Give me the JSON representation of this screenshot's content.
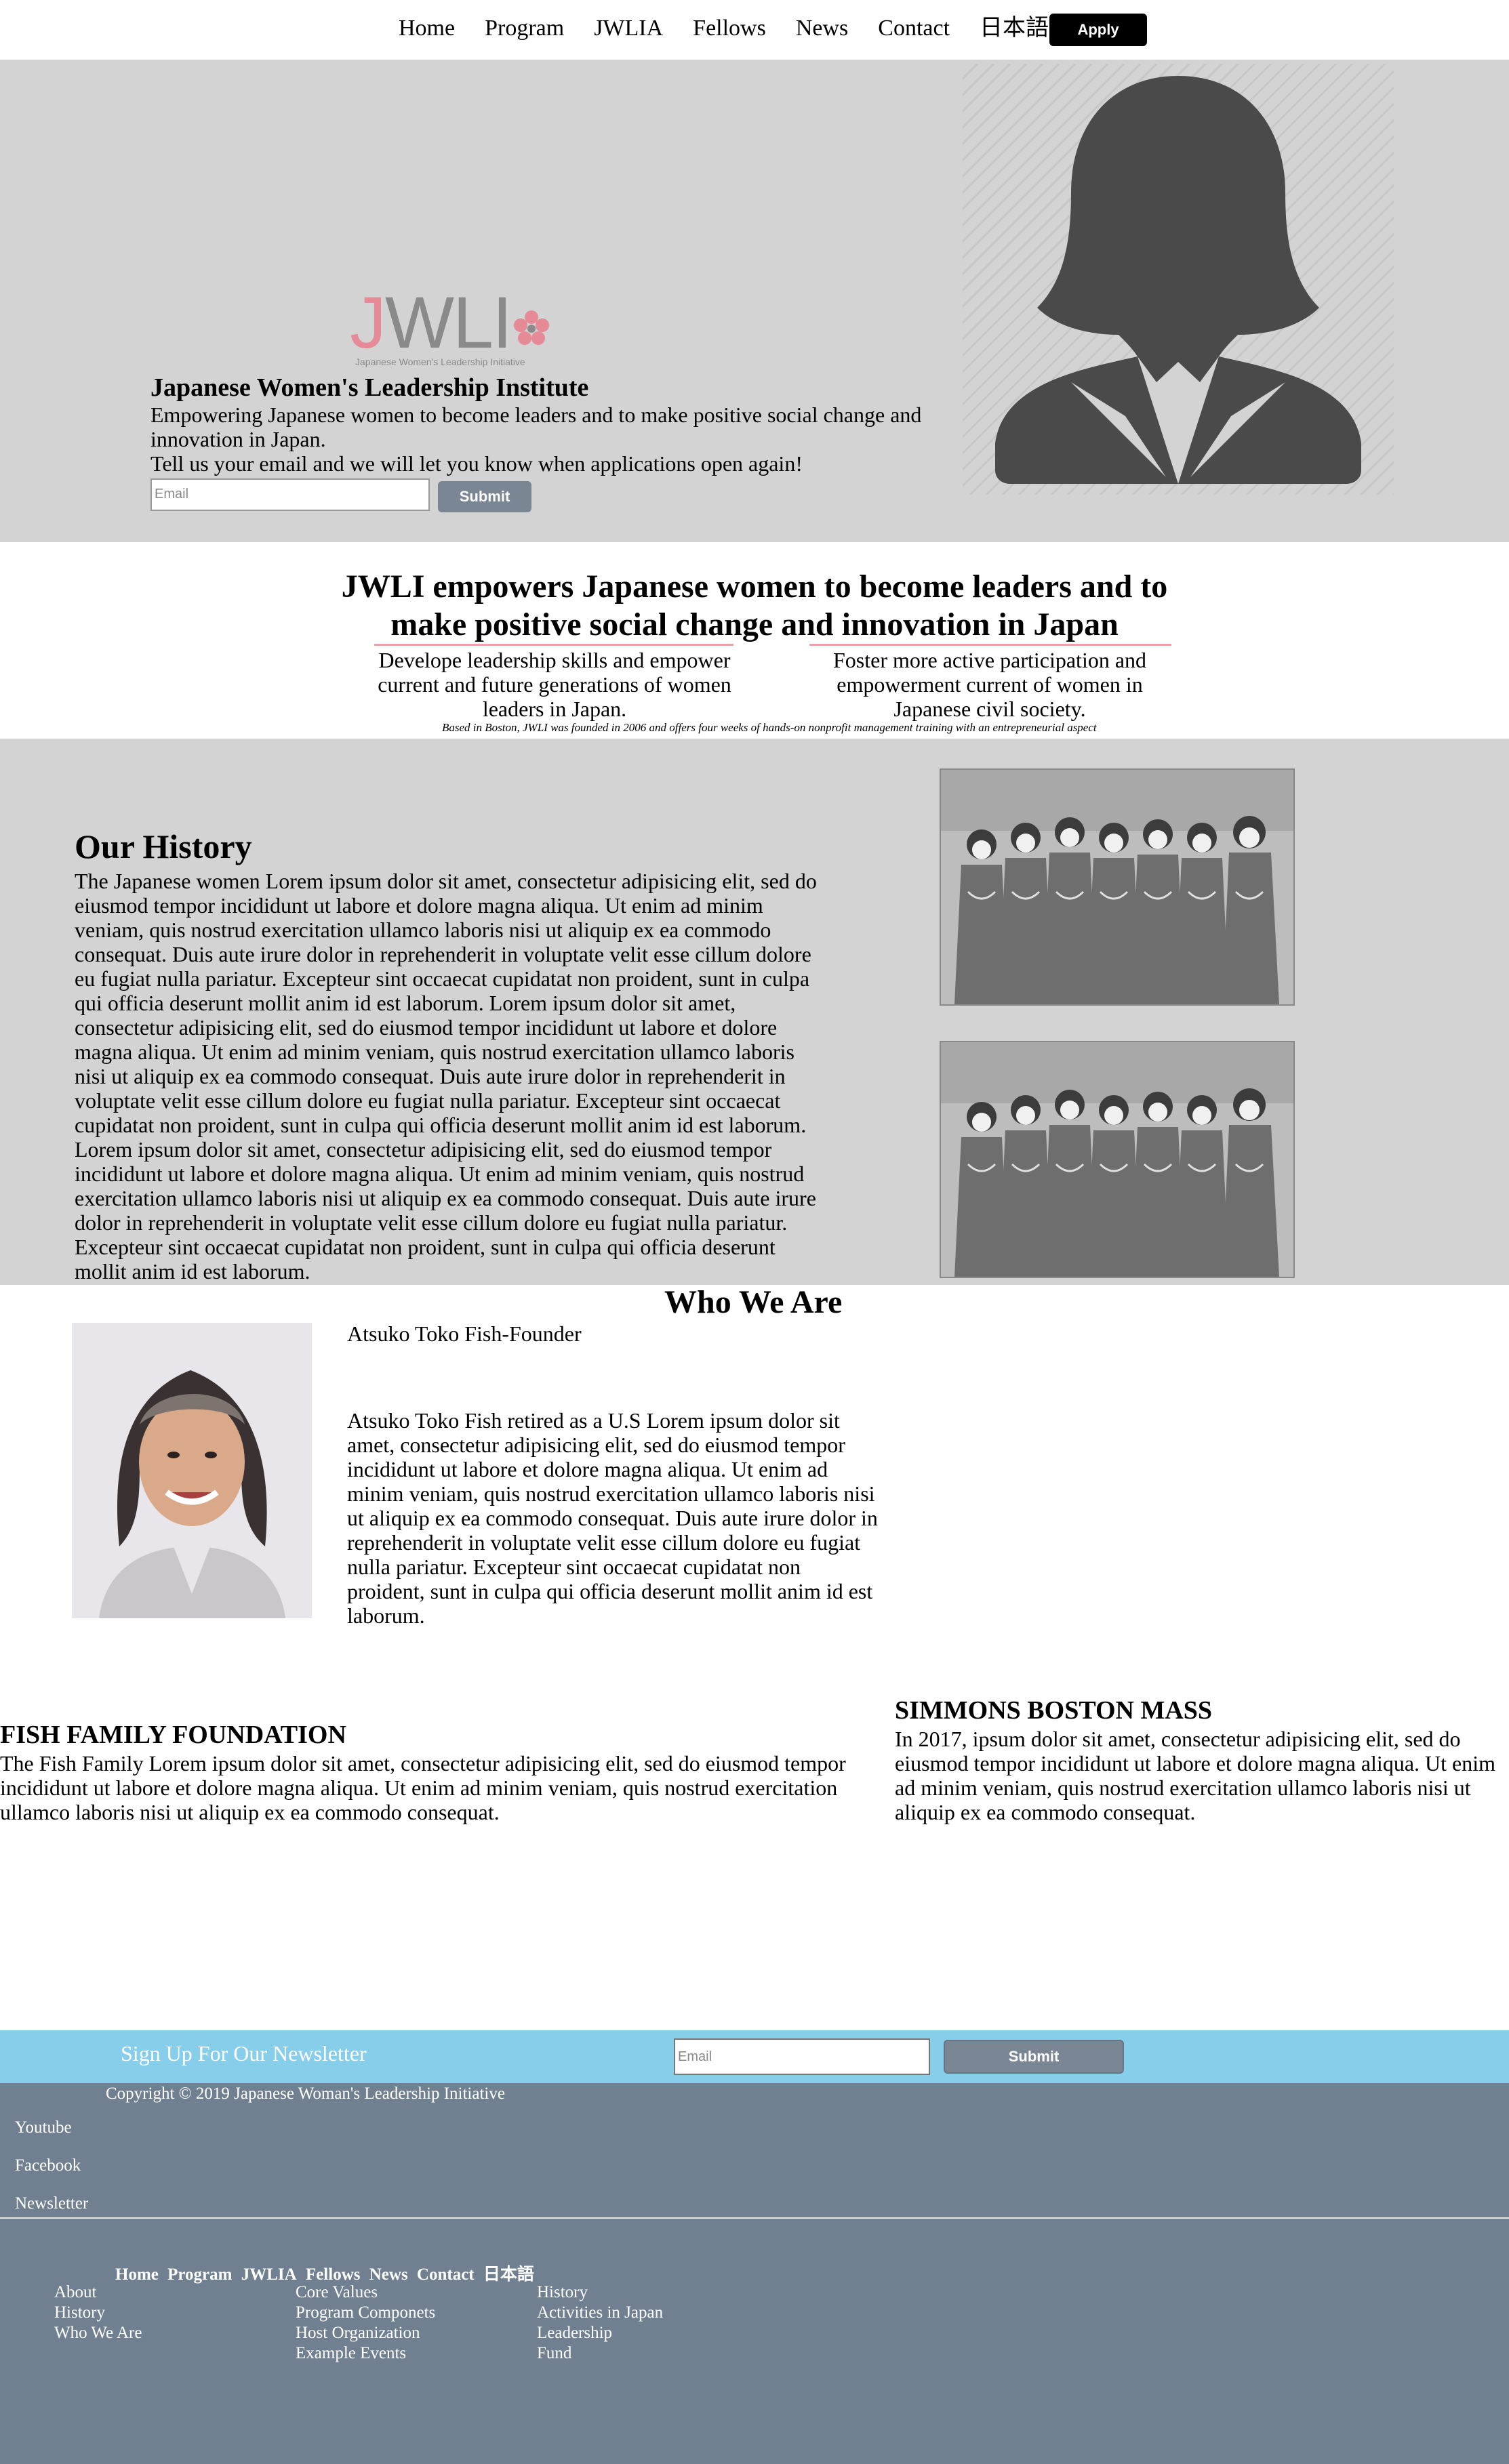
{
  "nav": {
    "items": [
      "Home",
      "Program",
      "JWLIA",
      "Fellows",
      "News",
      "Contact",
      "日本語"
    ],
    "apply_label": "Apply"
  },
  "hero": {
    "logo_text": "JWLI",
    "logo_tagline": "Japanese Women's Leadership Initiative",
    "title": "Japanese Women's Leadership Institute",
    "subtitle_1": "Empowering Japanese women to become leaders and to make positive social change and innovation in Japan.",
    "subtitle_2": "Tell us your email and we will let you know when applications open again!",
    "email_placeholder": "Email",
    "submit_label": "Submit"
  },
  "mission": {
    "headline": "JWLI empowers Japanese women to become leaders and to make positive social change and innovation in Japan",
    "col_left": "Develope leadership skills and empower current and future generations of women leaders in Japan.",
    "col_right": "Foster more active participation and empowerment current of women in Japanese civil society.",
    "note": "Based in Boston, JWLI was founded in 2006 and offers four weeks of hands-on nonprofit management training with an entrepreneurial aspect"
  },
  "history": {
    "title": "Our History",
    "text": "The Japanese women Lorem ipsum dolor sit amet, consectetur adipisicing elit, sed do eiusmod tempor incididunt ut labore et dolore magna aliqua. Ut enim ad minim veniam, quis nostrud exercitation ullamco laboris nisi ut aliquip ex ea commodo consequat. Duis aute irure dolor in reprehenderit in voluptate velit esse cillum dolore eu fugiat nulla pariatur. Excepteur sint occaecat cupidatat non proident, sunt in culpa qui officia deserunt mollit anim id est laborum. Lorem ipsum dolor sit amet, consectetur adipisicing elit, sed do eiusmod tempor incididunt ut labore et dolore magna aliqua. Ut enim ad minim veniam, quis nostrud exercitation ullamco laboris nisi ut aliquip ex ea commodo consequat. Duis aute irure dolor in reprehenderit in voluptate velit esse cillum dolore eu fugiat nulla pariatur. Excepteur sint occaecat cupidatat non proident, sunt in culpa qui officia deserunt mollit anim id est laborum. Lorem ipsum dolor sit amet, consectetur adipisicing elit, sed do eiusmod tempor incididunt ut labore et dolore magna aliqua. Ut enim ad minim veniam, quis nostrud exercitation ullamco laboris nisi ut aliquip ex ea commodo consequat. Duis aute irure dolor in reprehenderit in voluptate velit esse cillum dolore eu fugiat nulla pariatur. Excepteur sint occaecat cupidatat non proident, sunt in culpa qui officia deserunt mollit anim id est laborum."
  },
  "who": {
    "title": "Who We Are",
    "founder_name": "Atsuko Toko Fish-Founder",
    "founder_bio": "Atsuko Toko Fish retired as a U.S Lorem ipsum dolor sit amet, consectetur adipisicing elit, sed do eiusmod tempor incididunt ut labore et dolore magna aliqua. Ut enim ad minim veniam, quis nostrud exercitation ullamco laboris nisi ut aliquip ex ea commodo consequat. Duis aute irure dolor in reprehenderit in voluptate velit esse cillum dolore eu fugiat nulla pariatur. Excepteur sint occaecat cupidatat non proident, sunt in culpa qui officia deserunt mollit anim id est laborum."
  },
  "partners": {
    "fish_title": "FISH FAMILY FOUNDATION",
    "fish_text": "The Fish Family Lorem ipsum dolor sit amet, consectetur adipisicing elit, sed do eiusmod tempor incididunt ut labore et dolore magna aliqua. Ut enim ad minim veniam, quis nostrud exercitation ullamco laboris nisi ut aliquip ex ea commodo consequat.",
    "simmons_title": "SIMMONS BOSTON MASS",
    "simmons_text": "In 2017, ipsum dolor sit amet, consectetur adipisicing elit, sed do eiusmod tempor incididunt ut labore et dolore magna aliqua. Ut enim ad minim veniam, quis nostrud exercitation ullamco laboris nisi ut aliquip ex ea commodo consequat."
  },
  "newsletter": {
    "label": "Sign Up For Our Newsletter",
    "email_placeholder": "Email",
    "submit_label": "Submit"
  },
  "footer": {
    "copyright": "Copyright © 2019 Japanese Woman's Leadership Initiative",
    "social": [
      "Youtube",
      "Facebook",
      "Newsletter"
    ],
    "nav": [
      "Home",
      "Program",
      "JWLIA",
      "Fellows",
      "News",
      "Contact",
      "日本語"
    ],
    "col1": [
      "About",
      "History",
      "Who We Are"
    ],
    "col2": [
      "Core Values",
      "Program Componets",
      "Host Organization",
      "Example Events"
    ],
    "col3": [
      "History",
      "Activities in Japan",
      "Leadership",
      "Fund"
    ]
  },
  "colors": {
    "hero_bg": "#d3d3d3",
    "newsletter_bg": "#87ceeb",
    "footer_bg": "#708090",
    "button_gray": "#7b8694",
    "accent_pink": "#e58a96"
  }
}
